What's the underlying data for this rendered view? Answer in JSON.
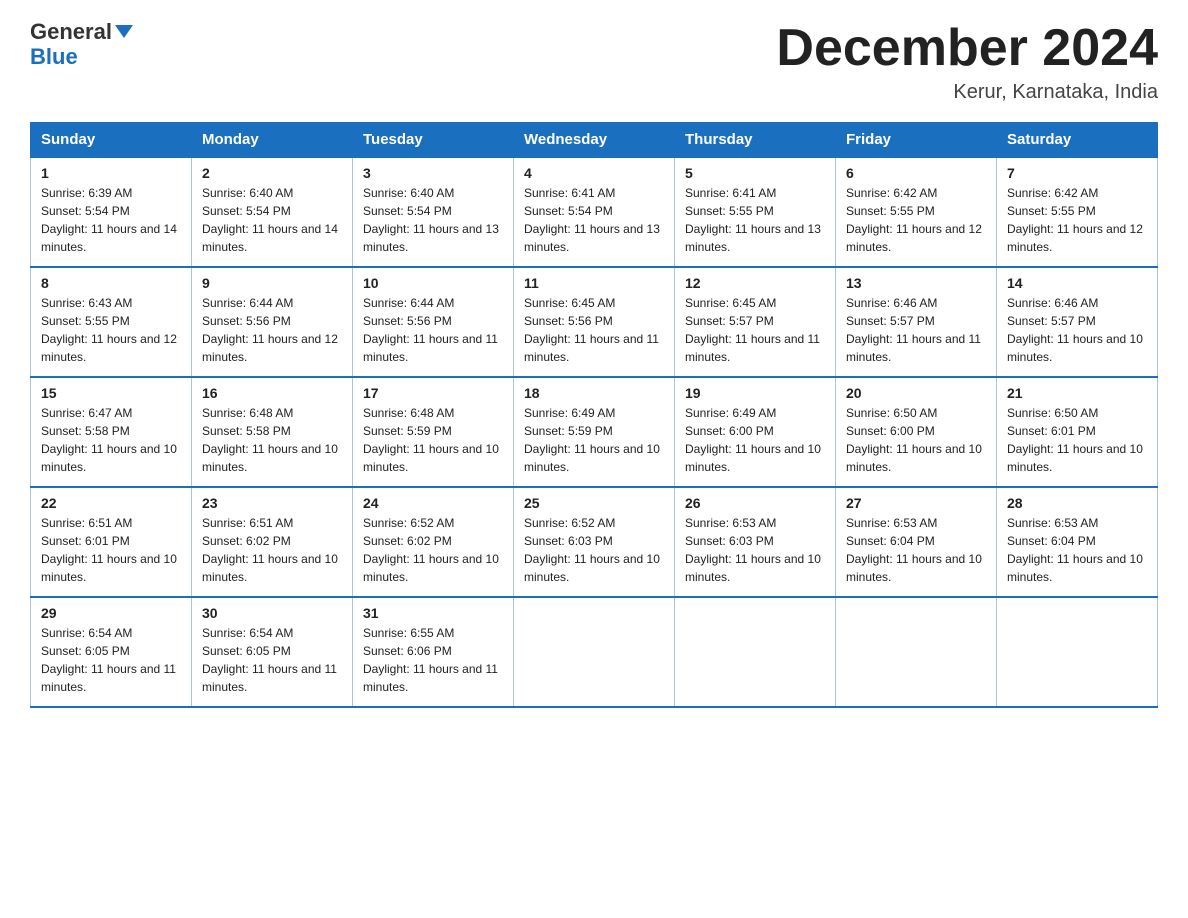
{
  "logo": {
    "line1": "General",
    "arrow": "▶",
    "line2": "Blue"
  },
  "header": {
    "month_year": "December 2024",
    "location": "Kerur, Karnataka, India"
  },
  "days_of_week": [
    "Sunday",
    "Monday",
    "Tuesday",
    "Wednesday",
    "Thursday",
    "Friday",
    "Saturday"
  ],
  "weeks": [
    [
      {
        "day": "1",
        "sunrise": "6:39 AM",
        "sunset": "5:54 PM",
        "daylight": "11 hours and 14 minutes."
      },
      {
        "day": "2",
        "sunrise": "6:40 AM",
        "sunset": "5:54 PM",
        "daylight": "11 hours and 14 minutes."
      },
      {
        "day": "3",
        "sunrise": "6:40 AM",
        "sunset": "5:54 PM",
        "daylight": "11 hours and 13 minutes."
      },
      {
        "day": "4",
        "sunrise": "6:41 AM",
        "sunset": "5:54 PM",
        "daylight": "11 hours and 13 minutes."
      },
      {
        "day": "5",
        "sunrise": "6:41 AM",
        "sunset": "5:55 PM",
        "daylight": "11 hours and 13 minutes."
      },
      {
        "day": "6",
        "sunrise": "6:42 AM",
        "sunset": "5:55 PM",
        "daylight": "11 hours and 12 minutes."
      },
      {
        "day": "7",
        "sunrise": "6:42 AM",
        "sunset": "5:55 PM",
        "daylight": "11 hours and 12 minutes."
      }
    ],
    [
      {
        "day": "8",
        "sunrise": "6:43 AM",
        "sunset": "5:55 PM",
        "daylight": "11 hours and 12 minutes."
      },
      {
        "day": "9",
        "sunrise": "6:44 AM",
        "sunset": "5:56 PM",
        "daylight": "11 hours and 12 minutes."
      },
      {
        "day": "10",
        "sunrise": "6:44 AM",
        "sunset": "5:56 PM",
        "daylight": "11 hours and 11 minutes."
      },
      {
        "day": "11",
        "sunrise": "6:45 AM",
        "sunset": "5:56 PM",
        "daylight": "11 hours and 11 minutes."
      },
      {
        "day": "12",
        "sunrise": "6:45 AM",
        "sunset": "5:57 PM",
        "daylight": "11 hours and 11 minutes."
      },
      {
        "day": "13",
        "sunrise": "6:46 AM",
        "sunset": "5:57 PM",
        "daylight": "11 hours and 11 minutes."
      },
      {
        "day": "14",
        "sunrise": "6:46 AM",
        "sunset": "5:57 PM",
        "daylight": "11 hours and 10 minutes."
      }
    ],
    [
      {
        "day": "15",
        "sunrise": "6:47 AM",
        "sunset": "5:58 PM",
        "daylight": "11 hours and 10 minutes."
      },
      {
        "day": "16",
        "sunrise": "6:48 AM",
        "sunset": "5:58 PM",
        "daylight": "11 hours and 10 minutes."
      },
      {
        "day": "17",
        "sunrise": "6:48 AM",
        "sunset": "5:59 PM",
        "daylight": "11 hours and 10 minutes."
      },
      {
        "day": "18",
        "sunrise": "6:49 AM",
        "sunset": "5:59 PM",
        "daylight": "11 hours and 10 minutes."
      },
      {
        "day": "19",
        "sunrise": "6:49 AM",
        "sunset": "6:00 PM",
        "daylight": "11 hours and 10 minutes."
      },
      {
        "day": "20",
        "sunrise": "6:50 AM",
        "sunset": "6:00 PM",
        "daylight": "11 hours and 10 minutes."
      },
      {
        "day": "21",
        "sunrise": "6:50 AM",
        "sunset": "6:01 PM",
        "daylight": "11 hours and 10 minutes."
      }
    ],
    [
      {
        "day": "22",
        "sunrise": "6:51 AM",
        "sunset": "6:01 PM",
        "daylight": "11 hours and 10 minutes."
      },
      {
        "day": "23",
        "sunrise": "6:51 AM",
        "sunset": "6:02 PM",
        "daylight": "11 hours and 10 minutes."
      },
      {
        "day": "24",
        "sunrise": "6:52 AM",
        "sunset": "6:02 PM",
        "daylight": "11 hours and 10 minutes."
      },
      {
        "day": "25",
        "sunrise": "6:52 AM",
        "sunset": "6:03 PM",
        "daylight": "11 hours and 10 minutes."
      },
      {
        "day": "26",
        "sunrise": "6:53 AM",
        "sunset": "6:03 PM",
        "daylight": "11 hours and 10 minutes."
      },
      {
        "day": "27",
        "sunrise": "6:53 AM",
        "sunset": "6:04 PM",
        "daylight": "11 hours and 10 minutes."
      },
      {
        "day": "28",
        "sunrise": "6:53 AM",
        "sunset": "6:04 PM",
        "daylight": "11 hours and 10 minutes."
      }
    ],
    [
      {
        "day": "29",
        "sunrise": "6:54 AM",
        "sunset": "6:05 PM",
        "daylight": "11 hours and 11 minutes."
      },
      {
        "day": "30",
        "sunrise": "6:54 AM",
        "sunset": "6:05 PM",
        "daylight": "11 hours and 11 minutes."
      },
      {
        "day": "31",
        "sunrise": "6:55 AM",
        "sunset": "6:06 PM",
        "daylight": "11 hours and 11 minutes."
      },
      null,
      null,
      null,
      null
    ]
  ]
}
